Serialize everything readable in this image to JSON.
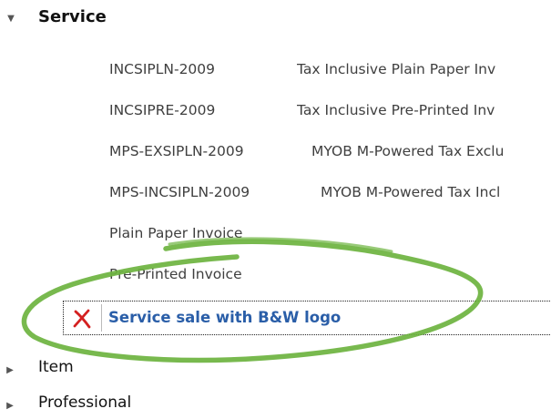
{
  "tree": {
    "service": {
      "label": "Service",
      "expanded": true,
      "forms": [
        {
          "code": "INCSIPLN-2009",
          "description": "Tax Inclusive Plain Paper Inv"
        },
        {
          "code": "INCSIPRE-2009",
          "description": "Tax Inclusive Pre-Printed Inv"
        },
        {
          "code": "MPS-EXSIPLN-2009",
          "description": "MYOB M-Powered Tax Exclu"
        },
        {
          "code": "MPS-INCSIPLN-2009",
          "description": "MYOB M-Powered Tax Incl"
        },
        {
          "code": "Plain Paper Invoice",
          "description": ""
        },
        {
          "code": "Pre-Printed Invoice",
          "description": ""
        }
      ],
      "selected_form": {
        "name": "Service sale with B&W logo",
        "delete_icon": "red-x-icon"
      }
    },
    "item": {
      "label": "Item",
      "expanded": false
    },
    "professional": {
      "label": "Professional",
      "expanded": false
    }
  },
  "colors": {
    "selected_text": "#2a5ea8",
    "delete_icon": "#d42020",
    "annotation_circle": "#6cb33f"
  }
}
